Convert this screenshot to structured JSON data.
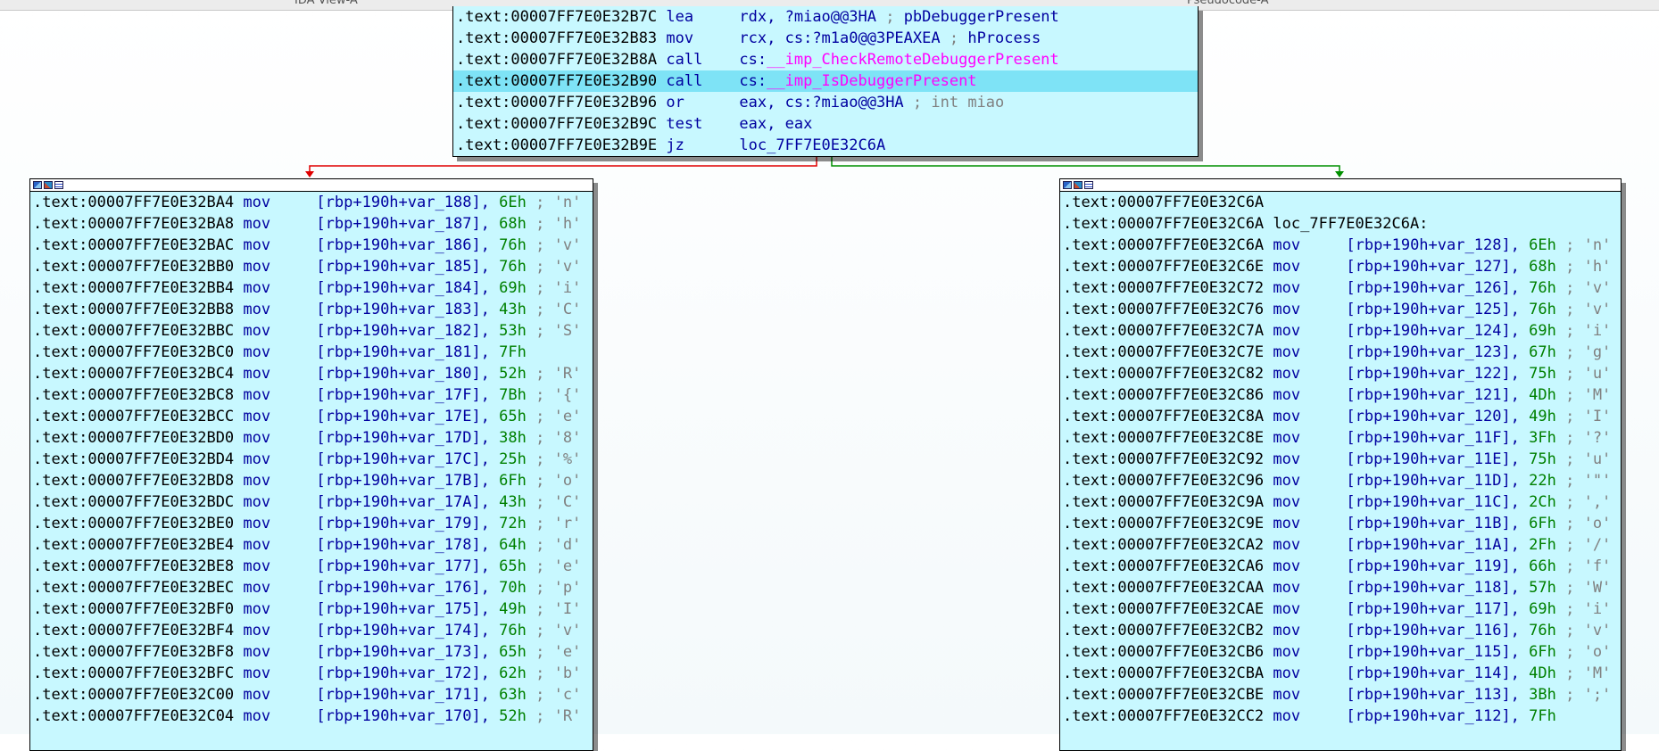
{
  "topbar": {
    "left_tab": "IDA View-A",
    "right_tab": "Pseudocode-A"
  },
  "top_block": {
    "lines": [
      {
        "addr": ".text:00007FF7E0E32B7C",
        "mnem": "lea",
        "ops": [
          {
            "t": "rdx, ",
            "c": "op"
          },
          {
            "t": "?miao@@3HA",
            "c": "op"
          },
          {
            "t": " ; ",
            "c": "cmt"
          },
          {
            "t": "pbDebuggerPresent",
            "c": "op"
          }
        ]
      },
      {
        "addr": ".text:00007FF7E0E32B83",
        "mnem": "mov",
        "ops": [
          {
            "t": "rcx, cs:",
            "c": "op"
          },
          {
            "t": "?m1a0@@3PEAXEA",
            "c": "op"
          },
          {
            "t": " ; ",
            "c": "cmt"
          },
          {
            "t": "hProcess",
            "c": "op"
          }
        ]
      },
      {
        "addr": ".text:00007FF7E0E32B8A",
        "mnem": "call",
        "ops": [
          {
            "t": "cs:",
            "c": "op"
          },
          {
            "t": "__imp_CheckRemoteDebuggerPresent",
            "c": "imp"
          }
        ]
      },
      {
        "addr": ".text:00007FF7E0E32B90",
        "mnem": "call",
        "hl": true,
        "ops": [
          {
            "t": "cs:",
            "c": "op"
          },
          {
            "t": "__imp_IsDebuggerPresent",
            "c": "imp"
          }
        ]
      },
      {
        "addr": ".text:00007FF7E0E32B96",
        "mnem": "or",
        "ops": [
          {
            "t": "eax, cs:",
            "c": "op"
          },
          {
            "t": "?miao@@3HA",
            "c": "op"
          },
          {
            "t": " ; int miao",
            "c": "cmt"
          }
        ]
      },
      {
        "addr": ".text:00007FF7E0E32B9C",
        "mnem": "test",
        "ops": [
          {
            "t": "eax, eax",
            "c": "op"
          }
        ]
      },
      {
        "addr": ".text:00007FF7E0E32B9E",
        "mnem": "jz",
        "ops": [
          {
            "t": "loc_7FF7E0E32C6A",
            "c": "op"
          }
        ]
      }
    ]
  },
  "left_block": {
    "lines": [
      {
        "addr": ".text:00007FF7E0E32BA4",
        "var": "var_188",
        "val": "6Eh",
        "ch": " ; 'n'"
      },
      {
        "addr": ".text:00007FF7E0E32BA8",
        "var": "var_187",
        "val": "68h",
        "ch": " ; 'h'"
      },
      {
        "addr": ".text:00007FF7E0E32BAC",
        "var": "var_186",
        "val": "76h",
        "ch": " ; 'v'"
      },
      {
        "addr": ".text:00007FF7E0E32BB0",
        "var": "var_185",
        "val": "76h",
        "ch": " ; 'v'"
      },
      {
        "addr": ".text:00007FF7E0E32BB4",
        "var": "var_184",
        "val": "69h",
        "ch": " ; 'i'"
      },
      {
        "addr": ".text:00007FF7E0E32BB8",
        "var": "var_183",
        "val": "43h",
        "ch": " ; 'C'"
      },
      {
        "addr": ".text:00007FF7E0E32BBC",
        "var": "var_182",
        "val": "53h",
        "ch": " ; 'S'"
      },
      {
        "addr": ".text:00007FF7E0E32BC0",
        "var": "var_181",
        "val": "7Fh",
        "ch": ""
      },
      {
        "addr": ".text:00007FF7E0E32BC4",
        "var": "var_180",
        "val": "52h",
        "ch": " ; 'R'"
      },
      {
        "addr": ".text:00007FF7E0E32BC8",
        "var": "var_17F",
        "val": "7Bh",
        "ch": " ; '{'"
      },
      {
        "addr": ".text:00007FF7E0E32BCC",
        "var": "var_17E",
        "val": "65h",
        "ch": " ; 'e'"
      },
      {
        "addr": ".text:00007FF7E0E32BD0",
        "var": "var_17D",
        "val": "38h",
        "ch": " ; '8'"
      },
      {
        "addr": ".text:00007FF7E0E32BD4",
        "var": "var_17C",
        "val": "25h",
        "ch": " ; '%'"
      },
      {
        "addr": ".text:00007FF7E0E32BD8",
        "var": "var_17B",
        "val": "6Fh",
        "ch": " ; 'o'"
      },
      {
        "addr": ".text:00007FF7E0E32BDC",
        "var": "var_17A",
        "val": "43h",
        "ch": " ; 'C'"
      },
      {
        "addr": ".text:00007FF7E0E32BE0",
        "var": "var_179",
        "val": "72h",
        "ch": " ; 'r'"
      },
      {
        "addr": ".text:00007FF7E0E32BE4",
        "var": "var_178",
        "val": "64h",
        "ch": " ; 'd'"
      },
      {
        "addr": ".text:00007FF7E0E32BE8",
        "var": "var_177",
        "val": "65h",
        "ch": " ; 'e'"
      },
      {
        "addr": ".text:00007FF7E0E32BEC",
        "var": "var_176",
        "val": "70h",
        "ch": " ; 'p'"
      },
      {
        "addr": ".text:00007FF7E0E32BF0",
        "var": "var_175",
        "val": "49h",
        "ch": " ; 'I'"
      },
      {
        "addr": ".text:00007FF7E0E32BF4",
        "var": "var_174",
        "val": "76h",
        "ch": " ; 'v'"
      },
      {
        "addr": ".text:00007FF7E0E32BF8",
        "var": "var_173",
        "val": "65h",
        "ch": " ; 'e'"
      },
      {
        "addr": ".text:00007FF7E0E32BFC",
        "var": "var_172",
        "val": "62h",
        "ch": " ; 'b'"
      },
      {
        "addr": ".text:00007FF7E0E32C00",
        "var": "var_171",
        "val": "63h",
        "ch": " ; 'c'"
      },
      {
        "addr": ".text:00007FF7E0E32C04",
        "var": "var_170",
        "val": "52h",
        "ch": " ; 'R'"
      }
    ]
  },
  "right_block": {
    "header": [
      {
        "addr": ".text:00007FF7E0E32C6A",
        "label": ""
      },
      {
        "addr": ".text:00007FF7E0E32C6A",
        "label": "loc_7FF7E0E32C6A:"
      }
    ],
    "lines": [
      {
        "addr": ".text:00007FF7E0E32C6A",
        "var": "var_128",
        "val": "6Eh",
        "ch": " ; 'n'"
      },
      {
        "addr": ".text:00007FF7E0E32C6E",
        "var": "var_127",
        "val": "68h",
        "ch": " ; 'h'"
      },
      {
        "addr": ".text:00007FF7E0E32C72",
        "var": "var_126",
        "val": "76h",
        "ch": " ; 'v'"
      },
      {
        "addr": ".text:00007FF7E0E32C76",
        "var": "var_125",
        "val": "76h",
        "ch": " ; 'v'"
      },
      {
        "addr": ".text:00007FF7E0E32C7A",
        "var": "var_124",
        "val": "69h",
        "ch": " ; 'i'"
      },
      {
        "addr": ".text:00007FF7E0E32C7E",
        "var": "var_123",
        "val": "67h",
        "ch": " ; 'g'"
      },
      {
        "addr": ".text:00007FF7E0E32C82",
        "var": "var_122",
        "val": "75h",
        "ch": " ; 'u'"
      },
      {
        "addr": ".text:00007FF7E0E32C86",
        "var": "var_121",
        "val": "4Dh",
        "ch": " ; 'M'"
      },
      {
        "addr": ".text:00007FF7E0E32C8A",
        "var": "var_120",
        "val": "49h",
        "ch": " ; 'I'"
      },
      {
        "addr": ".text:00007FF7E0E32C8E",
        "var": "var_11F",
        "val": "3Fh",
        "ch": " ; '?'"
      },
      {
        "addr": ".text:00007FF7E0E32C92",
        "var": "var_11E",
        "val": "75h",
        "ch": " ; 'u'"
      },
      {
        "addr": ".text:00007FF7E0E32C96",
        "var": "var_11D",
        "val": "22h",
        "ch": " ; '\"'"
      },
      {
        "addr": ".text:00007FF7E0E32C9A",
        "var": "var_11C",
        "val": "2Ch",
        "ch": " ; ','"
      },
      {
        "addr": ".text:00007FF7E0E32C9E",
        "var": "var_11B",
        "val": "6Fh",
        "ch": " ; 'o'"
      },
      {
        "addr": ".text:00007FF7E0E32CA2",
        "var": "var_11A",
        "val": "2Fh",
        "ch": " ; '/'"
      },
      {
        "addr": ".text:00007FF7E0E32CA6",
        "var": "var_119",
        "val": "66h",
        "ch": " ; 'f'"
      },
      {
        "addr": ".text:00007FF7E0E32CAA",
        "var": "var_118",
        "val": "57h",
        "ch": " ; 'W'"
      },
      {
        "addr": ".text:00007FF7E0E32CAE",
        "var": "var_117",
        "val": "69h",
        "ch": " ; 'i'"
      },
      {
        "addr": ".text:00007FF7E0E32CB2",
        "var": "var_116",
        "val": "76h",
        "ch": " ; 'v'"
      },
      {
        "addr": ".text:00007FF7E0E32CB6",
        "var": "var_115",
        "val": "6Fh",
        "ch": " ; 'o'"
      },
      {
        "addr": ".text:00007FF7E0E32CBA",
        "var": "var_114",
        "val": "4Dh",
        "ch": " ; 'M'"
      },
      {
        "addr": ".text:00007FF7E0E32CBE",
        "var": "var_113",
        "val": "3Bh",
        "ch": " ; ';'"
      },
      {
        "addr": ".text:00007FF7E0E32CC2",
        "var": "var_112",
        "val": "7Fh",
        "ch": ""
      }
    ]
  },
  "mov_mnemonic": "mov",
  "operand_prefix": "[rbp+190h+",
  "operand_suffix": "], ",
  "colors": {
    "node_bg": "#c8f8ff",
    "highlight": "#7ee3f6",
    "edge_false": "#e00000",
    "edge_true": "#009000",
    "import": "#ff00ff",
    "operand": "#0000a0",
    "number": "#008000",
    "comment": "#808080"
  }
}
